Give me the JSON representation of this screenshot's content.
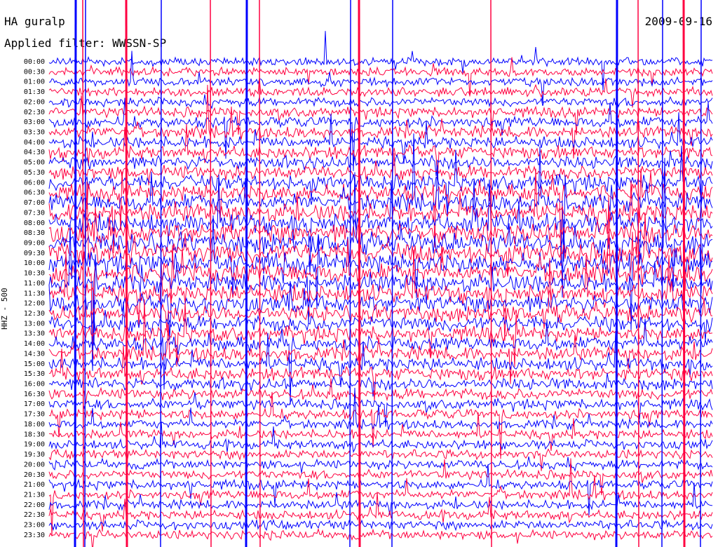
{
  "header": {
    "title": "HA guralp",
    "filter": "Applied filter: WWSSN-SP",
    "date": "2009-09-16"
  },
  "chart_data": {
    "type": "line",
    "title": "HA guralp",
    "subtitle": "Applied filter: WWSSN-SP",
    "date": "2009-09-16",
    "ylabel": "HHZ - 500",
    "row_interval_minutes": 30,
    "row_labels": [
      "00:00",
      "00:30",
      "01:00",
      "01:30",
      "02:00",
      "02:30",
      "03:00",
      "03:30",
      "04:00",
      "04:30",
      "05:00",
      "05:30",
      "06:00",
      "06:30",
      "07:00",
      "07:30",
      "08:00",
      "08:30",
      "09:00",
      "09:30",
      "10:00",
      "10:30",
      "11:00",
      "11:30",
      "12:00",
      "12:30",
      "13:00",
      "13:30",
      "14:00",
      "14:30",
      "15:00",
      "15:30",
      "16:00",
      "16:30",
      "17:00",
      "17:30",
      "18:00",
      "18:30",
      "19:00",
      "19:30",
      "20:00",
      "20:30",
      "21:00",
      "21:30",
      "22:00",
      "22:30",
      "23:00",
      "23:30"
    ],
    "series_colors": [
      "#0000ff",
      "#ff0040"
    ],
    "relative_activity": [
      0.2,
      0.2,
      0.2,
      0.22,
      0.25,
      0.3,
      0.35,
      0.4,
      0.4,
      0.45,
      0.45,
      0.5,
      0.6,
      0.65,
      0.7,
      0.75,
      0.8,
      0.85,
      0.9,
      0.9,
      0.85,
      0.8,
      0.75,
      0.7,
      0.7,
      0.65,
      0.6,
      0.55,
      0.5,
      0.5,
      0.45,
      0.45,
      0.4,
      0.35,
      0.3,
      0.3,
      0.25,
      0.25,
      0.25,
      0.25,
      0.25,
      0.25,
      0.25,
      0.25,
      0.25,
      0.25,
      0.25,
      0.25
    ],
    "grid": false
  }
}
